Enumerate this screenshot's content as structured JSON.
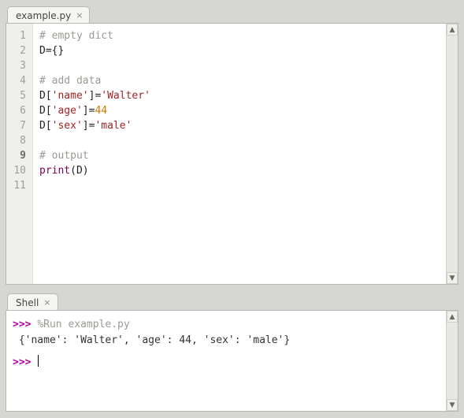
{
  "editor": {
    "tab_label": "example.py",
    "lines": [
      {
        "n": 1,
        "tokens": [
          [
            "# empty dict",
            "comment"
          ]
        ]
      },
      {
        "n": 2,
        "tokens": [
          [
            "D",
            "ident"
          ],
          [
            "=",
            "punct"
          ],
          [
            "{}",
            "punct"
          ]
        ]
      },
      {
        "n": 3,
        "tokens": []
      },
      {
        "n": 4,
        "tokens": [
          [
            "# add data",
            "comment"
          ]
        ]
      },
      {
        "n": 5,
        "tokens": [
          [
            "D",
            "ident"
          ],
          [
            "[",
            "punct"
          ],
          [
            "'name'",
            "string"
          ],
          [
            "]",
            "punct"
          ],
          [
            "=",
            "punct"
          ],
          [
            "'Walter'",
            "string"
          ]
        ]
      },
      {
        "n": 6,
        "tokens": [
          [
            "D",
            "ident"
          ],
          [
            "[",
            "punct"
          ],
          [
            "'age'",
            "string"
          ],
          [
            "]",
            "punct"
          ],
          [
            "=",
            "punct"
          ],
          [
            "44",
            "number"
          ]
        ]
      },
      {
        "n": 7,
        "tokens": [
          [
            "D",
            "ident"
          ],
          [
            "[",
            "punct"
          ],
          [
            "'sex'",
            "string"
          ],
          [
            "]",
            "punct"
          ],
          [
            "=",
            "punct"
          ],
          [
            "'male'",
            "string"
          ]
        ]
      },
      {
        "n": 8,
        "tokens": []
      },
      {
        "n": 9,
        "bold": true,
        "tokens": [
          [
            "# output",
            "comment"
          ]
        ]
      },
      {
        "n": 10,
        "tokens": [
          [
            "print",
            "builtin"
          ],
          [
            "(",
            "punct"
          ],
          [
            "D",
            "ident"
          ],
          [
            ")",
            "punct"
          ]
        ]
      },
      {
        "n": 11,
        "tokens": []
      }
    ]
  },
  "shell": {
    "tab_label": "Shell",
    "prompt": ">>>",
    "run_cmd": "%Run example.py",
    "output": "{'name': 'Walter', 'age': 44, 'sex': 'male'}"
  },
  "scroll_glyphs": {
    "up": "▲",
    "down": "▼"
  }
}
